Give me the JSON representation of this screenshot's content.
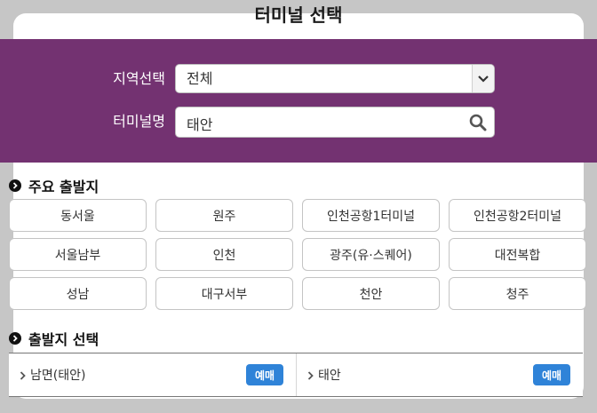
{
  "modal": {
    "title": "터미널 선택"
  },
  "filters": {
    "region_label": "지역선택",
    "region_value": "전체",
    "terminal_label": "터미널명",
    "terminal_value": "태안"
  },
  "major_departures": {
    "title": "주요 출발지",
    "items": [
      "동서울",
      "원주",
      "인천공항1터미널",
      "인천공항2터미널",
      "서울남부",
      "인천",
      "광주(유·스퀘어)",
      "대전복합",
      "성남",
      "대구서부",
      "천안",
      "청주"
    ]
  },
  "departure_select": {
    "title": "출발지 선택",
    "rows": [
      {
        "name": "남면(태안)",
        "action": "예매"
      },
      {
        "name": "태안",
        "action": "예매"
      }
    ]
  },
  "colors": {
    "header_bg": "#733271",
    "reserve_button": "#2f83d8",
    "backdrop": "#c6c6c6"
  },
  "icons": [
    "chevron-down-icon",
    "search-icon",
    "arrow-right-circle-icon",
    "chevron-right-icon"
  ]
}
